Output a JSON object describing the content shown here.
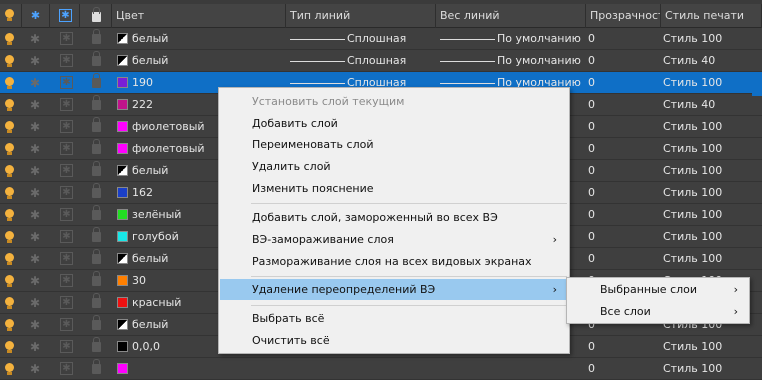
{
  "columns": {
    "color": "Цвет",
    "linetype": "Тип линий",
    "lineweight": "Вес линий",
    "transparency": "Прозрачност",
    "plotstyle": "Стиль печати"
  },
  "rows": [
    {
      "color_name": "белый",
      "swatch": "half",
      "swatch_color": "#ffffff",
      "linetype": "Сплошная",
      "lineweight": "По умолчанию",
      "transparency": "0",
      "plot_style": "Стиль 100"
    },
    {
      "color_name": "белый",
      "swatch": "half",
      "swatch_color": "#ffffff",
      "linetype": "Сплошная",
      "lineweight": "По умолчанию",
      "transparency": "0",
      "plot_style": "Стиль 40"
    },
    {
      "color_name": "190",
      "swatch": "solid",
      "swatch_color": "#7a1fd6",
      "linetype": "Сплошная",
      "lineweight": "По умолчанию",
      "transparency": "0",
      "plot_style": "Стиль 100",
      "selected": true
    },
    {
      "color_name": "222",
      "swatch": "solid",
      "swatch_color": "#c0138a",
      "linetype": "",
      "lineweight": "",
      "transparency": "0",
      "plot_style": "Стиль 40"
    },
    {
      "color_name": "фиолетовый",
      "swatch": "solid",
      "swatch_color": "#ff00ff",
      "linetype": "",
      "lineweight": "",
      "transparency": "0",
      "plot_style": "Стиль 100"
    },
    {
      "color_name": "фиолетовый",
      "swatch": "solid",
      "swatch_color": "#ff00ff",
      "linetype": "",
      "lineweight": "",
      "transparency": "0",
      "plot_style": "Стиль 100"
    },
    {
      "color_name": "белый",
      "swatch": "half",
      "swatch_color": "#ffffff",
      "linetype": "",
      "lineweight": "",
      "transparency": "0",
      "plot_style": "Стиль 100"
    },
    {
      "color_name": "162",
      "swatch": "solid",
      "swatch_color": "#1a3fc8",
      "linetype": "",
      "lineweight": "",
      "transparency": "0",
      "plot_style": "Стиль 100"
    },
    {
      "color_name": "зелёный",
      "swatch": "solid",
      "swatch_color": "#22dd22",
      "linetype": "",
      "lineweight": "",
      "transparency": "0",
      "plot_style": "Стиль 100"
    },
    {
      "color_name": "голубой",
      "swatch": "solid",
      "swatch_color": "#18e6e6",
      "linetype": "",
      "lineweight": "",
      "transparency": "0",
      "plot_style": "Стиль 100"
    },
    {
      "color_name": "белый",
      "swatch": "half",
      "swatch_color": "#ffffff",
      "linetype": "",
      "lineweight": "",
      "transparency": "0",
      "plot_style": "Стиль 100"
    },
    {
      "color_name": "30",
      "swatch": "solid",
      "swatch_color": "#ff7f00",
      "linetype": "",
      "lineweight": "",
      "transparency": "0",
      "plot_style": "Стиль 100"
    },
    {
      "color_name": "красный",
      "swatch": "solid",
      "swatch_color": "#ee1111",
      "linetype": "",
      "lineweight": "",
      "transparency": "0",
      "plot_style": "Стиль 100"
    },
    {
      "color_name": "белый",
      "swatch": "half",
      "swatch_color": "#ffffff",
      "linetype": "",
      "lineweight": "",
      "transparency": "0",
      "plot_style": "Стиль 100"
    },
    {
      "color_name": "0,0,0",
      "swatch": "solid",
      "swatch_color": "#000000",
      "linetype": "",
      "lineweight": "",
      "transparency": "0",
      "plot_style": "Стиль 100"
    },
    {
      "color_name": "",
      "swatch": "solid",
      "swatch_color": "#ff00ff",
      "linetype": "",
      "lineweight": "",
      "transparency": "0",
      "plot_style": "Стиль 100"
    }
  ],
  "context_menu": {
    "items": [
      {
        "label": "Установить слой текущим",
        "disabled": true
      },
      {
        "label": "Добавить слой"
      },
      {
        "label": "Переименовать слой"
      },
      {
        "label": "Удалить слой"
      },
      {
        "label": "Изменить пояснение"
      },
      {
        "label": "Добавить слой, замороженный во всех ВЭ"
      },
      {
        "label": "ВЭ-замораживание слоя",
        "submenu": true
      },
      {
        "label": "Размораживание слоя на всех видовых экранах"
      },
      {
        "label": "Удаление переопределений ВЭ",
        "submenu": true,
        "highlighted": true
      },
      {
        "label": "Выбрать всё"
      },
      {
        "label": "Очистить всё"
      }
    ]
  },
  "submenu": {
    "items": [
      {
        "label": "Выбранные слои"
      },
      {
        "label": "Все слои"
      }
    ]
  },
  "icons": {
    "submenu_arrow": "›"
  }
}
